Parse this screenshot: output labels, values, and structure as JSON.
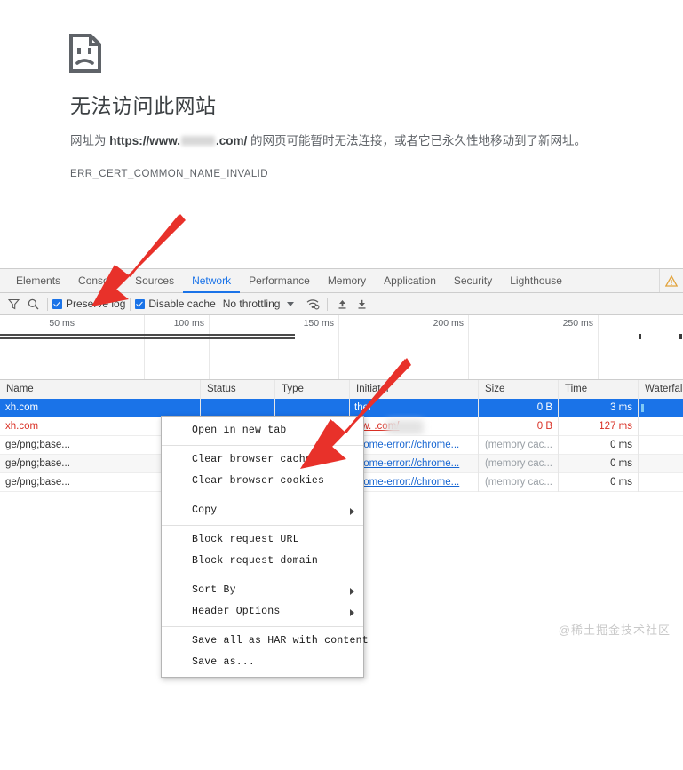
{
  "error_page": {
    "icon": "sad-document-icon",
    "heading": "无法访问此网站",
    "body_prefix": "网址为 ",
    "body_url_start": "https://www.",
    "body_url_end": ".com/",
    "body_suffix": " 的网页可能暂时无法连接，或者它已永久性地移动到了新网址。",
    "error_code": "ERR_CERT_COMMON_NAME_INVALID"
  },
  "devtools": {
    "tabs": [
      {
        "label": "Elements",
        "active": false
      },
      {
        "label": "Console",
        "active": false
      },
      {
        "label": "Sources",
        "active": false
      },
      {
        "label": "Network",
        "active": true
      },
      {
        "label": "Performance",
        "active": false
      },
      {
        "label": "Memory",
        "active": false
      },
      {
        "label": "Application",
        "active": false
      },
      {
        "label": "Security",
        "active": false
      },
      {
        "label": "Lighthouse",
        "active": false
      }
    ],
    "warning_icon": "warning-triangle-icon",
    "toolbar": {
      "filter_icon": "filter-funnel-icon",
      "search_icon": "search-magnifier-icon",
      "preserve_log_label": "Preserve log",
      "preserve_log_checked": true,
      "disable_cache_label": "Disable cache",
      "disable_cache_checked": true,
      "throttling_label": "No throttling",
      "throttle_caret_icon": "chevron-down-icon",
      "wifi_icon": "network-conditions-wifi-icon",
      "import_icon": "import-har-up-arrow-icon",
      "export_icon": "export-har-down-arrow-icon"
    },
    "overview": {
      "ticks": [
        "50 ms",
        "100 ms",
        "150 ms",
        "200 ms",
        "250 ms"
      ]
    },
    "table": {
      "columns": [
        "Name",
        "Status",
        "Type",
        "Initiator",
        "Size",
        "Time",
        "Waterfall"
      ],
      "rows": [
        {
          "name": "xh.com",
          "status": "",
          "type": "",
          "initiator": "ther",
          "size": "0 B",
          "time": "3 ms",
          "state": "selected"
        },
        {
          "name": "xh.com",
          "status": "",
          "type": "",
          "initiator": "ww.        .com/",
          "size": "0 B",
          "time": "127 ms",
          "state": "error"
        },
        {
          "name": "ge/png;base...",
          "status": "",
          "type": "",
          "initiator": "hrome-error://chrome...",
          "size": "(memory cac...",
          "time": "0 ms",
          "state": "plain"
        },
        {
          "name": "ge/png;base...",
          "status": "",
          "type": "",
          "initiator": "hrome-error://chrome...",
          "size": "(memory cac...",
          "time": "0 ms",
          "state": "alt"
        },
        {
          "name": "ge/png;base...",
          "status": "",
          "type": "",
          "initiator": "hrome-error://chrome...",
          "size": "(memory cac...",
          "time": "0 ms",
          "state": "plain"
        }
      ]
    },
    "context_menu": {
      "items": [
        {
          "label": "Open in new tab",
          "submenu": false,
          "sep_after": true
        },
        {
          "label": "Clear browser cache",
          "submenu": false,
          "sep_after": false
        },
        {
          "label": "Clear browser cookies",
          "submenu": false,
          "sep_after": true
        },
        {
          "label": "Copy",
          "submenu": true,
          "sep_after": true
        },
        {
          "label": "Block request URL",
          "submenu": false,
          "sep_after": false
        },
        {
          "label": "Block request domain",
          "submenu": false,
          "sep_after": true
        },
        {
          "label": "Sort By",
          "submenu": true,
          "sep_after": false
        },
        {
          "label": "Header Options",
          "submenu": true,
          "sep_after": true
        },
        {
          "label": "Save all as HAR with content",
          "submenu": false,
          "sep_after": false
        },
        {
          "label": "Save as...",
          "submenu": false,
          "sep_after": false
        }
      ]
    }
  },
  "annotations": {
    "arrow_color": "#e8312a",
    "arrow_1_target": "Preserve log checkbox",
    "arrow_2_target": "Clear browser cache menu item"
  },
  "watermark": {
    "text": "@稀土掘金技术社区"
  },
  "colors": {
    "accent": "#1a73e8",
    "error": "#d93025",
    "arrow": "#e8312a",
    "panel_bg": "#f3f3f3"
  }
}
